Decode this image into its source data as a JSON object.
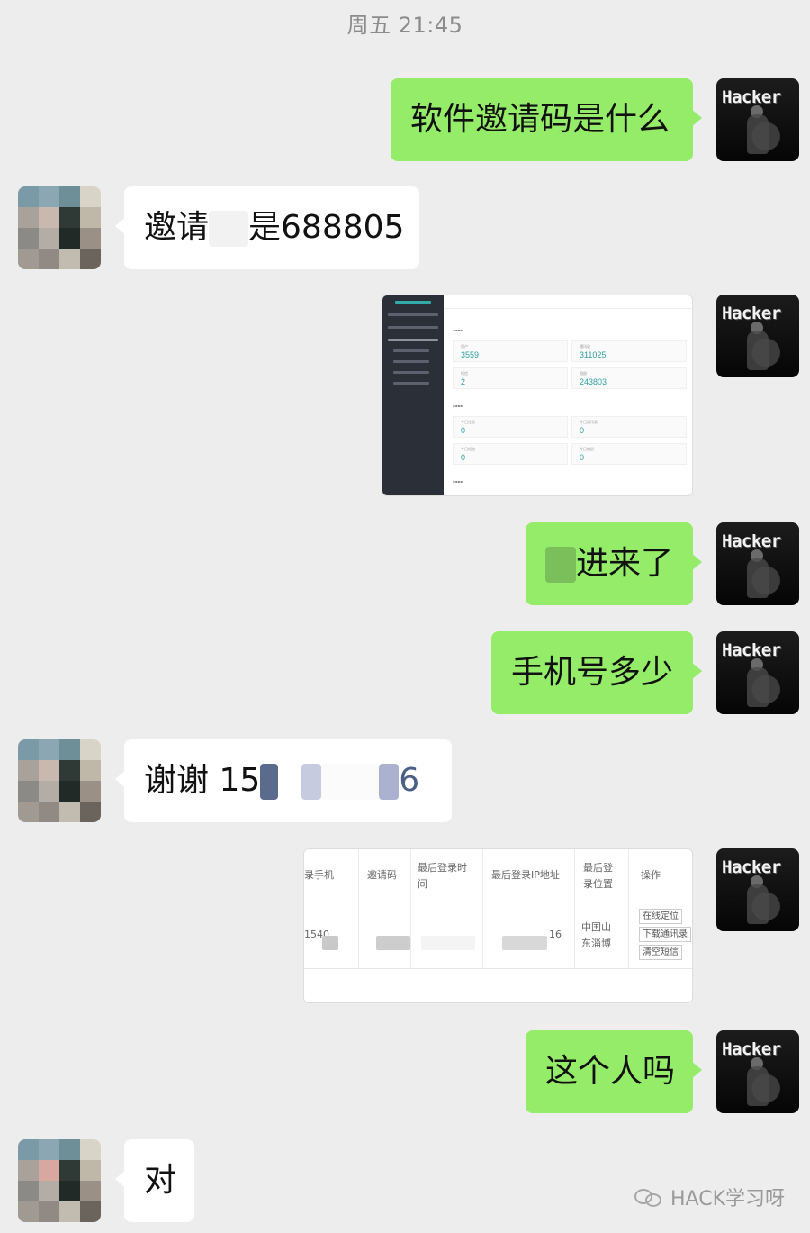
{
  "timestamp": "周五 21:45",
  "messages": {
    "m1": "软件邀请码是什么",
    "m2_prefix": "邀请",
    "m2_suffix": "是688805",
    "m4_suffix": "进来了",
    "m5": "手机号多少",
    "m6_prefix": "谢谢 15",
    "m6_suffix": "6",
    "m8": "这个人吗",
    "m9": "对"
  },
  "avatar_me": {
    "label": "Hacker",
    "icon": "hacker-avatar"
  },
  "dashboard_shot": {
    "cards": [
      {
        "label": "用户",
        "value": "3559"
      },
      {
        "label": "通讯录",
        "value": "311025"
      },
      {
        "label": "短信",
        "value": "2"
      },
      {
        "label": "相册",
        "value": "243803"
      },
      {
        "label": "今日注册",
        "value": "0"
      },
      {
        "label": "今日通讯录",
        "value": "0"
      },
      {
        "label": "今日短信",
        "value": "0"
      },
      {
        "label": "今日相册",
        "value": "0"
      }
    ]
  },
  "table_shot": {
    "headers": [
      "录手机",
      "邀请码",
      "最后登录时间",
      "最后登录IP地址",
      "最后登录位置",
      "操作"
    ],
    "row": {
      "phone": "1540",
      "ip_tail": "16",
      "location": "中国山东淄博"
    },
    "buttons": [
      "在线定位",
      "下载通讯录",
      "清空短信"
    ]
  },
  "watermark": "HACK学习呀",
  "colors": {
    "bg": "#ededed",
    "me_bubble": "#95ec69",
    "other_bubble": "#ffffff",
    "teal": "#2fa0a0"
  }
}
